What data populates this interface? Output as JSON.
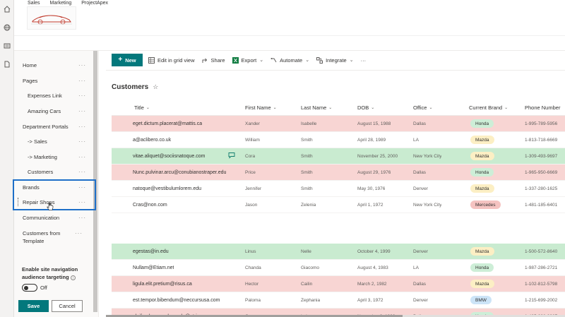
{
  "header": {
    "hub_links": [
      "Sales",
      "Marketing",
      "ProjectApex"
    ]
  },
  "rail_icons": [
    "home-icon",
    "globe-icon",
    "news-icon",
    "document-icon"
  ],
  "nav": {
    "items": [
      {
        "label": "Home",
        "level": 0
      },
      {
        "label": "Pages",
        "level": 0
      },
      {
        "label": "Expenses Link",
        "level": 1
      },
      {
        "label": "Amazing Cars",
        "level": 1
      },
      {
        "label": "Department Portals",
        "level": 0
      },
      {
        "label": "-> Sales",
        "level": 1
      },
      {
        "label": "-> Marketing",
        "level": 1
      },
      {
        "label": "Customers",
        "level": 1
      },
      {
        "label": "Brands",
        "level": 0
      },
      {
        "label": "Repair Shops",
        "level": 0
      },
      {
        "label": "Communication",
        "level": 0
      },
      {
        "label": "Customers from Template",
        "level": 0
      }
    ],
    "more_glyph": "···",
    "audience_label": "Enable site navigation audience targeting",
    "toggle_text": "Off",
    "save_label": "Save",
    "cancel_label": "Cancel"
  },
  "commands": {
    "new_label": "New",
    "edit_grid": "Edit in grid view",
    "share": "Share",
    "export": "Export",
    "automate": "Automate",
    "integrate": "Integrate",
    "more": "···"
  },
  "list": {
    "title": "Customers",
    "columns": [
      "Title",
      "First Name",
      "Last Name",
      "DOB",
      "Office",
      "Current Brand",
      "Phone Number"
    ]
  },
  "colors": {
    "red_row": "#f8d5d3",
    "green_row": "#c9ebd0",
    "brand_Honda": "#cdeed7",
    "brand_Mazda": "#fcefc4",
    "brand_Mercedes": "#f5c3c1",
    "brand_BMW": "#cce4f7",
    "accent": "#03787c",
    "highlight": "#1e6fc8"
  },
  "rows_group1": [
    {
      "title": "eget.dictum.placerat@mattis.ca",
      "first": "Xander",
      "last": "Isabelle",
      "dob": "August 15, 1988",
      "office": "Dallas",
      "brand": "Honda",
      "phone": "1-995-789-5956",
      "color": "red"
    },
    {
      "title": "a@aclibero.co.uk",
      "first": "William",
      "last": "Smith",
      "dob": "April 28, 1989",
      "office": "LA",
      "brand": "Mazda",
      "phone": "1-813-718-6669",
      "color": "white"
    },
    {
      "title": "vitae.aliquet@sociisnatoque.com",
      "first": "Cora",
      "last": "Smith",
      "dob": "November 25, 2000",
      "office": "New York City",
      "brand": "Mazda",
      "phone": "1-309-493-9697",
      "color": "green",
      "chat": true
    },
    {
      "title": "Nunc.pulvinar.arcu@conubianostraper.edu",
      "first": "Price",
      "last": "Smith",
      "dob": "August 29, 1976",
      "office": "Dallas",
      "brand": "Honda",
      "phone": "1-965-950-6669",
      "color": "red"
    },
    {
      "title": "natoque@vestibulumlorem.edu",
      "first": "Jennifer",
      "last": "Smith",
      "dob": "May 30, 1976",
      "office": "Denver",
      "brand": "Mazda",
      "phone": "1-337-280-1625",
      "color": "white"
    },
    {
      "title": "Cras@non.com",
      "first": "Jason",
      "last": "Zelenia",
      "dob": "April 1, 1972",
      "office": "New York City",
      "brand": "Mercedes",
      "phone": "1-481-185-6401",
      "color": "white"
    }
  ],
  "rows_group2": [
    {
      "title": "egestas@in.edu",
      "first": "Linus",
      "last": "Nelle",
      "dob": "October 4, 1999",
      "office": "Denver",
      "brand": "Mazda",
      "phone": "1-500-572-8640",
      "color": "green"
    },
    {
      "title": "Nullam@Etiam.net",
      "first": "Chanda",
      "last": "Giacomo",
      "dob": "August 4, 1983",
      "office": "LA",
      "brand": "Honda",
      "phone": "1-987-286-2721",
      "color": "white"
    },
    {
      "title": "ligula.elit.pretium@risus.ca",
      "first": "Hector",
      "last": "Cailin",
      "dob": "March 2, 1982",
      "office": "Dallas",
      "brand": "Mazda",
      "phone": "1-102-812-5798",
      "color": "red"
    },
    {
      "title": "est.tempor.bibendum@neccursusa.com",
      "first": "Paloma",
      "last": "Zephania",
      "dob": "April 3, 1972",
      "office": "Denver",
      "brand": "BMW",
      "phone": "1-215-699-2002",
      "color": "white"
    },
    {
      "title": "eleifend.nec.malesuada@atrisus.ca",
      "first": "Cora",
      "last": "Luke",
      "dob": "November 2, 1983",
      "office": "Dallas",
      "brand": "Honda",
      "phone": "1-405-998-9987",
      "color": "red"
    }
  ]
}
